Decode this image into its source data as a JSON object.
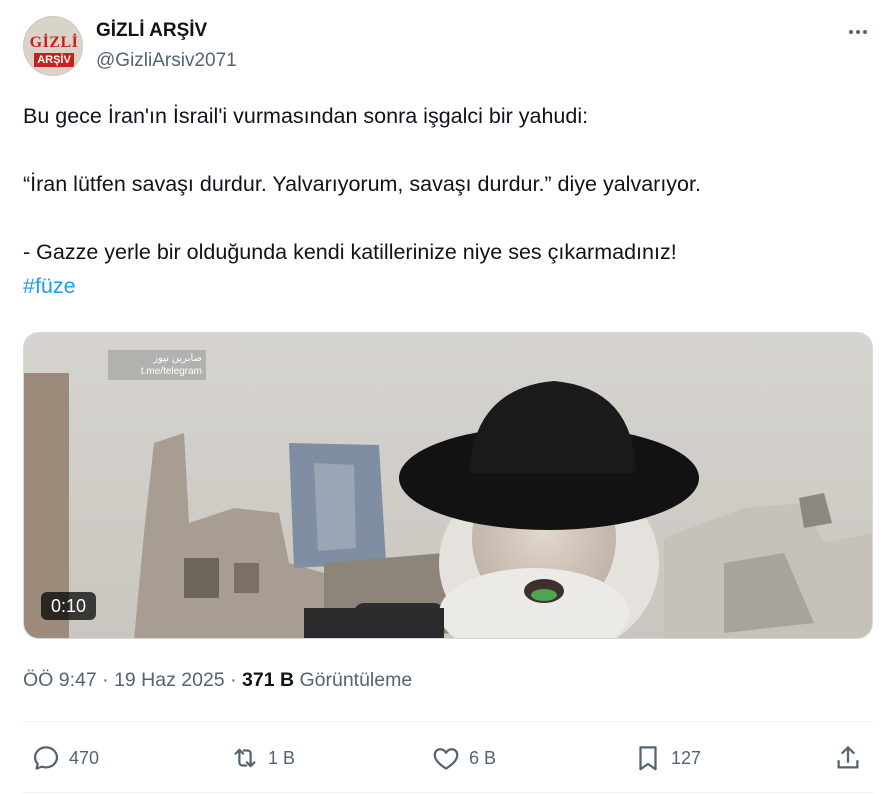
{
  "author": {
    "avatar_text_top": "GİZLİ",
    "avatar_text_bottom": "ARŞİV",
    "name": "GİZLİ ARŞİV",
    "handle": "@GizliArsiv2071"
  },
  "tweet": {
    "line1": "Bu gece İran'ın İsrail'i vurmasından sonra işgalci bir yahudi:",
    "line2": "“İran lütfen savaşı durdur. Yalvarıyorum, savaşı durdur.” diye yalvarıyor.",
    "line3": "- Gazze yerle bir olduğunda kendi katillerinize niye ses çıkarmadınız!",
    "hashtag": "#füze"
  },
  "media": {
    "duration": "0:10",
    "watermark_line1": "صابرين نيوز",
    "watermark_line2": "t.me/telegram"
  },
  "meta": {
    "time": "ÖÖ 9:47",
    "date": "19 Haz 2025",
    "views_count": "371 B",
    "views_label": "Görüntüleme"
  },
  "actions": {
    "replies": "470",
    "reposts": "1 B",
    "likes": "6 B",
    "bookmarks": "127"
  },
  "colors": {
    "accent": "#1d9bf0",
    "secondary_text": "#536471",
    "primary_text": "#0f1419"
  }
}
